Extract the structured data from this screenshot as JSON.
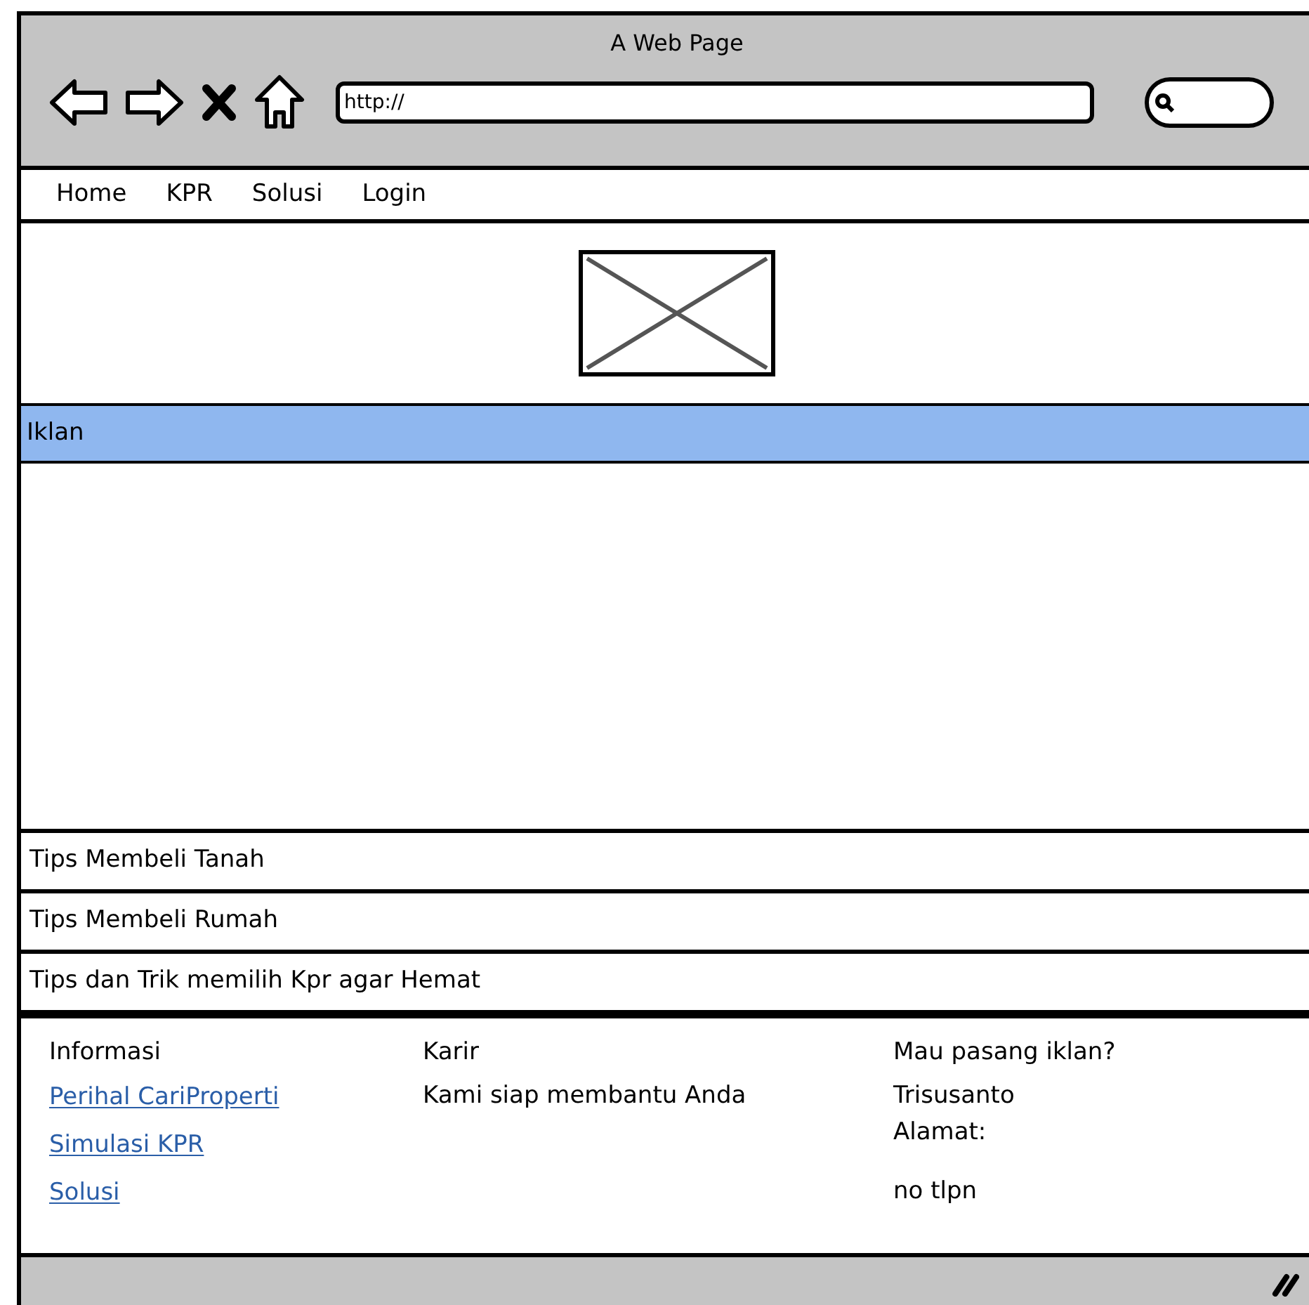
{
  "window": {
    "title": "A Web Page"
  },
  "address_bar": {
    "value": "http://"
  },
  "nav": {
    "items": [
      {
        "label": "Home"
      },
      {
        "label": "KPR"
      },
      {
        "label": "Solusi"
      },
      {
        "label": "Login"
      }
    ]
  },
  "ad_section": {
    "title": "Iklan"
  },
  "tips": [
    {
      "label": "Tips Membeli Tanah"
    },
    {
      "label": "Tips Membeli Rumah"
    },
    {
      "label": "Tips dan Trik memilih Kpr agar Hemat"
    }
  ],
  "footer": {
    "columns": [
      {
        "heading": "Informasi",
        "lines": [
          {
            "kind": "link",
            "text": "Perihal CariProperti"
          },
          {
            "kind": "link",
            "text": "Simulasi KPR"
          },
          {
            "kind": "link",
            "text": "Solusi"
          }
        ]
      },
      {
        "heading": "Karir",
        "lines": [
          {
            "kind": "text",
            "text": "Kami siap membantu Anda"
          }
        ]
      },
      {
        "heading": "Mau pasang iklan?",
        "lines": [
          {
            "kind": "text",
            "text": "Trisusanto"
          },
          {
            "kind": "text",
            "text": "Alamat:"
          },
          {
            "kind": "gap"
          },
          {
            "kind": "text",
            "text": "no tlpn"
          }
        ]
      }
    ]
  }
}
